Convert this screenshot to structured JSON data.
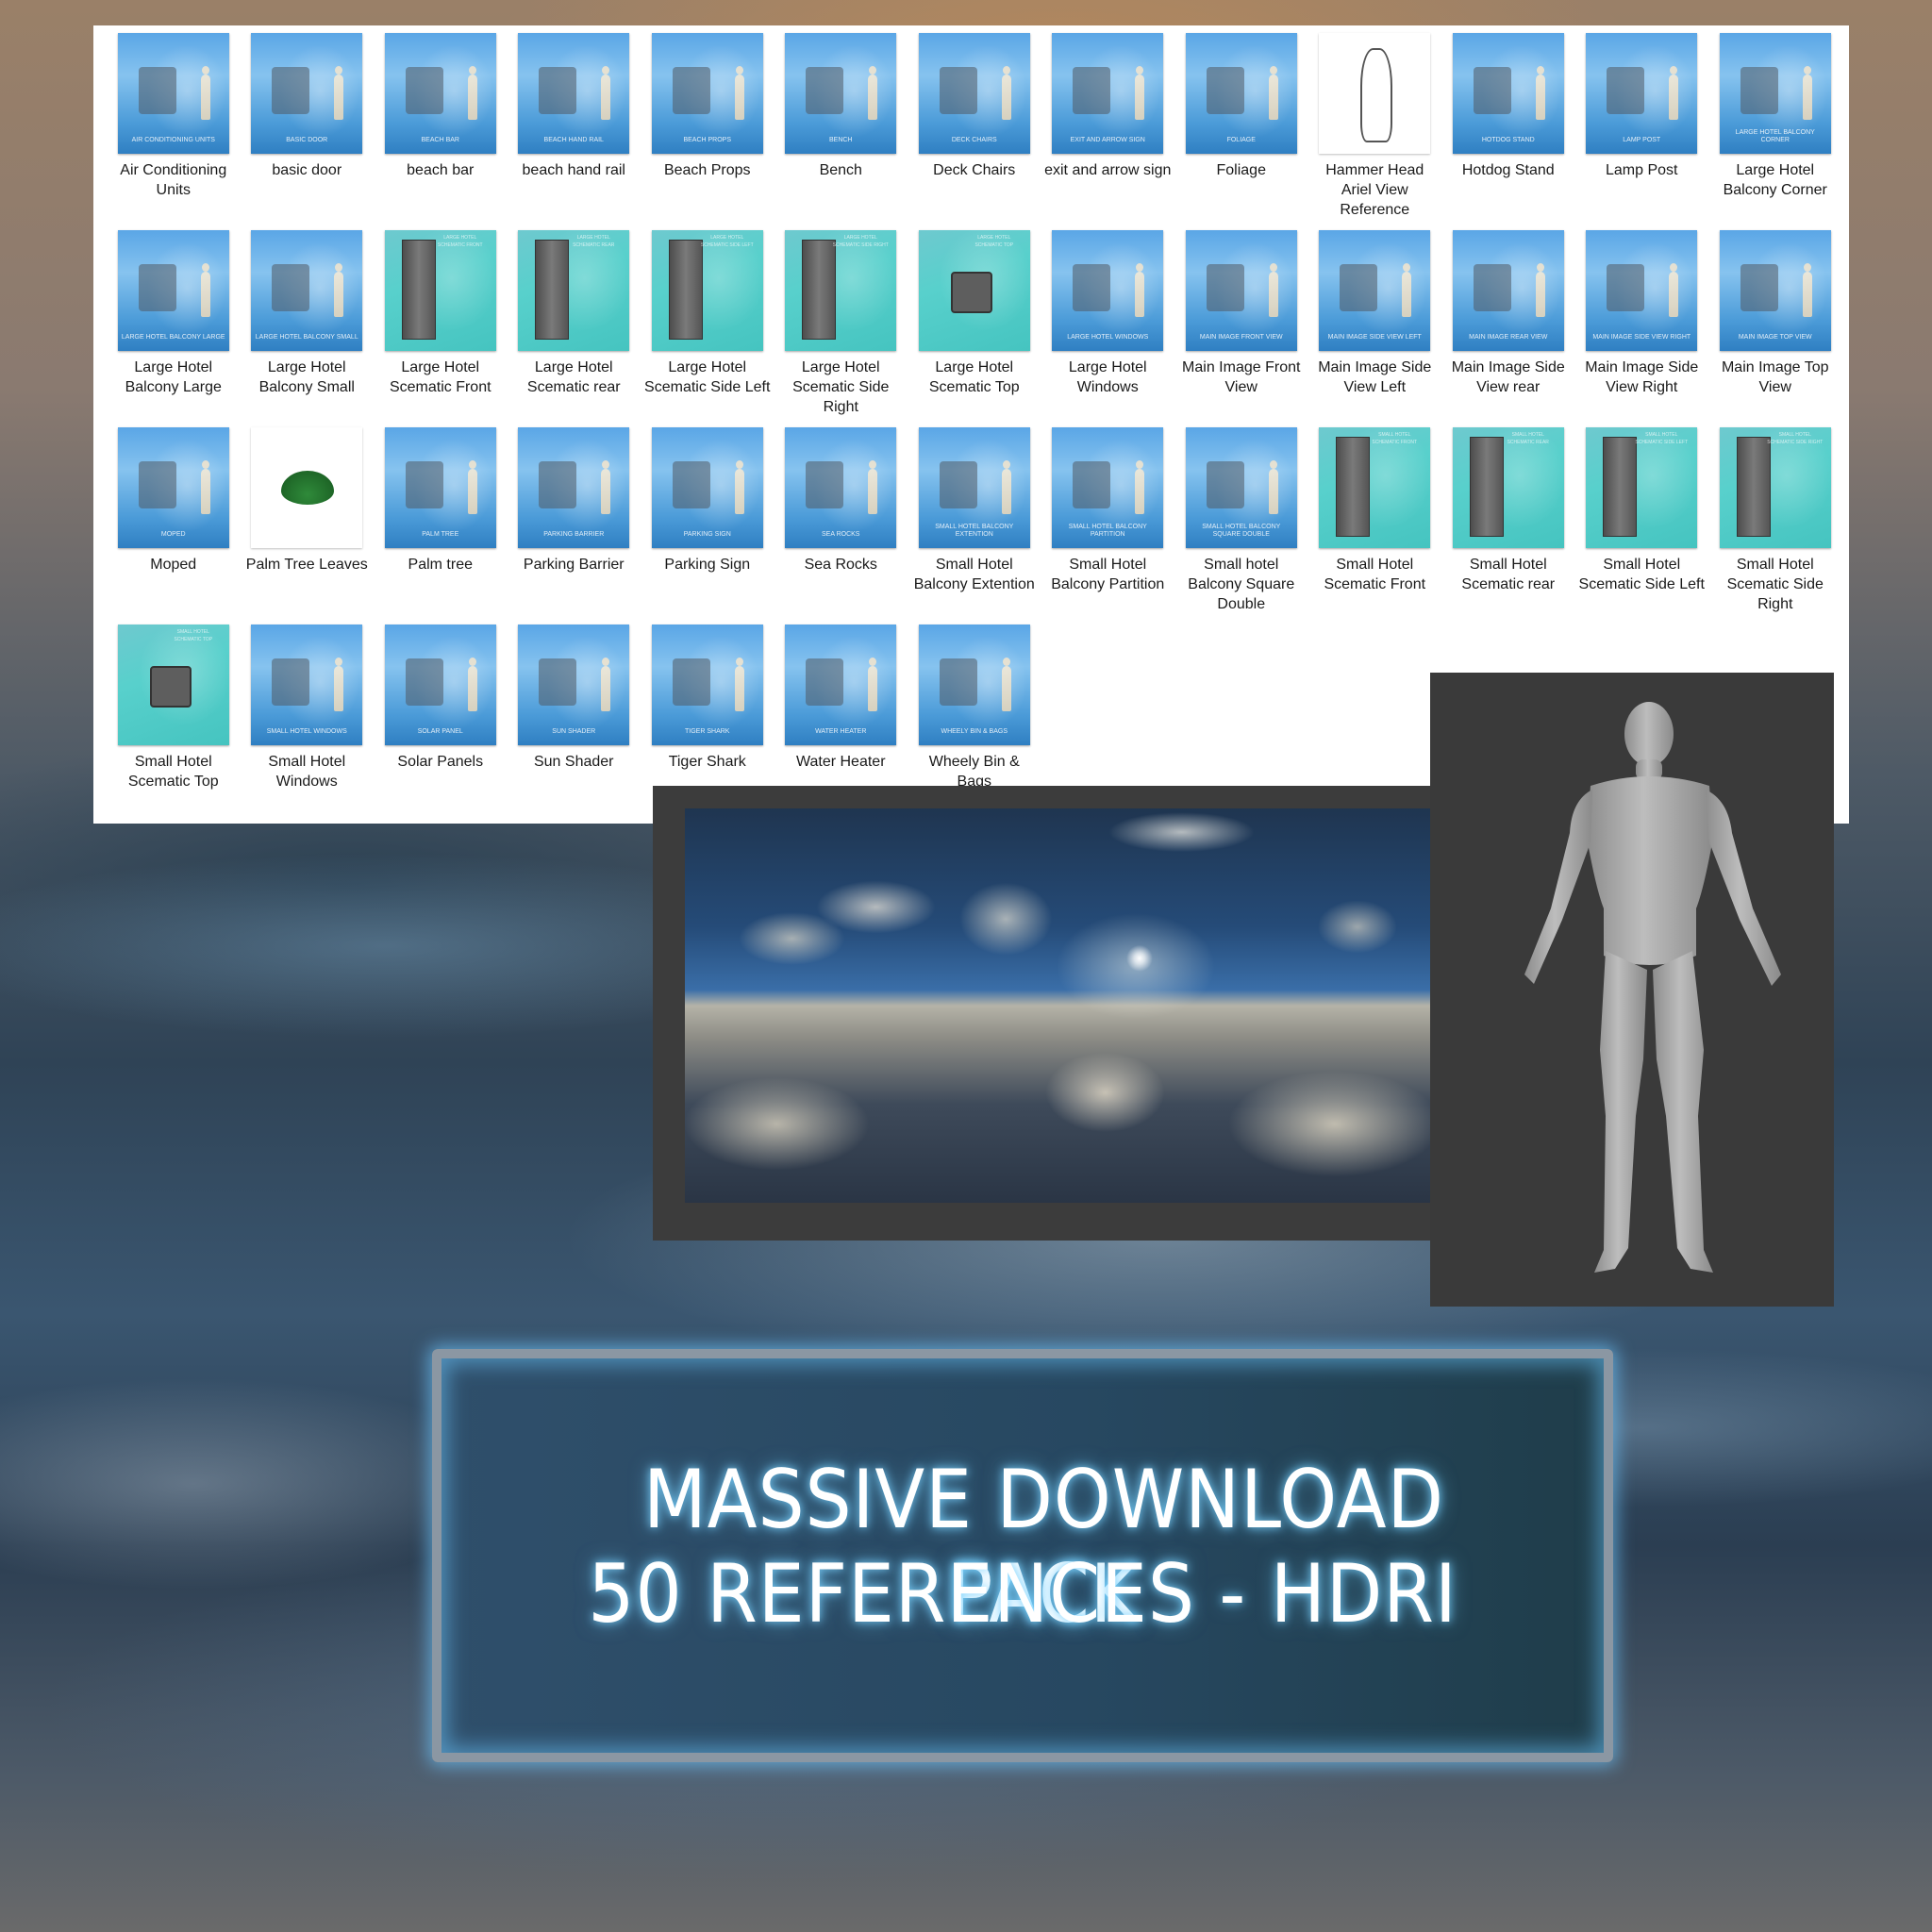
{
  "explorer": {
    "files": [
      {
        "label": "Air Conditioning Units",
        "thumb_caption": "AIR CONDITIONING UNITS",
        "style": "blue",
        "icon": "air-conditioner-icon"
      },
      {
        "label": "basic door",
        "thumb_caption": "BASIC DOOR",
        "style": "blue",
        "icon": "door-icon"
      },
      {
        "label": "beach bar",
        "thumb_caption": "BEACH BAR",
        "style": "blue",
        "icon": "beach-bar-icon"
      },
      {
        "label": "beach hand rail",
        "thumb_caption": "BEACH HAND RAIL",
        "style": "blue",
        "icon": "hand-rail-icon"
      },
      {
        "label": "Beach Props",
        "thumb_caption": "BEACH PROPS",
        "style": "blue",
        "icon": "surfboard-icon"
      },
      {
        "label": "Bench",
        "thumb_caption": "BENCH",
        "style": "blue",
        "icon": "bench-icon"
      },
      {
        "label": "Deck Chairs",
        "thumb_caption": "DECK CHAIRS",
        "style": "blue",
        "icon": "deck-chair-icon"
      },
      {
        "label": "exit and arrow sign",
        "thumb_caption": "EXIT AND ARROW SIGN",
        "style": "blue",
        "icon": "exit-sign-icon"
      },
      {
        "label": "Foliage",
        "thumb_caption": "FOLIAGE",
        "style": "blue",
        "icon": "foliage-icon"
      },
      {
        "label": "Hammer Head Ariel View Reference",
        "thumb_caption": "",
        "style": "white",
        "icon": "hammerhead-shark-icon"
      },
      {
        "label": "Hotdog Stand",
        "thumb_caption": "HOTDOG STAND",
        "style": "blue",
        "icon": "hotdog-stand-icon"
      },
      {
        "label": "Lamp Post",
        "thumb_caption": "LAMP POST",
        "style": "blue",
        "icon": "lamp-post-icon"
      },
      {
        "label": "Large Hotel Balcony Corner",
        "thumb_caption": "LARGE HOTEL BALCONY CORNER",
        "style": "blue",
        "icon": "balcony-icon"
      },
      {
        "label": "Large Hotel Balcony Large",
        "thumb_caption": "LARGE HOTEL BALCONY LARGE",
        "style": "blue",
        "icon": "balcony-icon"
      },
      {
        "label": "Large Hotel Balcony Small",
        "thumb_caption": "LARGE HOTEL BALCONY SMALL",
        "style": "blue",
        "icon": "balcony-icon"
      },
      {
        "label": "Large Hotel Scematic Front",
        "thumb_caption": "LARGE HOTEL SCHEMATIC FRONT",
        "style": "teal",
        "icon": "building-icon"
      },
      {
        "label": "Large Hotel Scematic rear",
        "thumb_caption": "LARGE HOTEL SCHEMATIC REAR",
        "style": "teal",
        "icon": "building-icon"
      },
      {
        "label": "Large Hotel Scematic Side Left",
        "thumb_caption": "LARGE HOTEL SCHEMATIC SIDE LEFT",
        "style": "teal",
        "icon": "building-icon"
      },
      {
        "label": "Large Hotel Scematic Side Right",
        "thumb_caption": "LARGE HOTEL SCHEMATIC SIDE RIGHT",
        "style": "teal",
        "icon": "building-icon"
      },
      {
        "label": "Large Hotel Scematic Top",
        "thumb_caption": "LARGE HOTEL SCHEMATIC TOP",
        "style": "teal",
        "icon": "building-top-icon"
      },
      {
        "label": "Large Hotel Windows",
        "thumb_caption": "LARGE HOTEL WINDOWS",
        "style": "blue",
        "icon": "window-icon"
      },
      {
        "label": "Main Image Front View",
        "thumb_caption": "MAIN IMAGE FRONT VIEW",
        "style": "blue",
        "icon": "hotel-scene-icon"
      },
      {
        "label": "Main Image Side View Left",
        "thumb_caption": "MAIN IMAGE SIDE VIEW LEFT",
        "style": "blue",
        "icon": "hotel-scene-icon"
      },
      {
        "label": "Main Image Side View rear",
        "thumb_caption": "MAIN IMAGE REAR VIEW",
        "style": "blue",
        "icon": "hotel-scene-icon"
      },
      {
        "label": "Main Image Side View Right",
        "thumb_caption": "MAIN IMAGE SIDE VIEW RIGHT",
        "style": "blue",
        "icon": "hotel-scene-icon"
      },
      {
        "label": "Main Image Top View",
        "thumb_caption": "MAIN IMAGE TOP VIEW",
        "style": "blue",
        "icon": "map-top-view-icon"
      },
      {
        "label": "Moped",
        "thumb_caption": "MOPED",
        "style": "blue",
        "icon": "moped-icon"
      },
      {
        "label": "Palm Tree Leaves",
        "thumb_caption": "",
        "style": "white",
        "icon": "palm-leaf-icon"
      },
      {
        "label": "Palm tree",
        "thumb_caption": "PALM TREE",
        "style": "blue",
        "icon": "palm-tree-icon"
      },
      {
        "label": "Parking Barrier",
        "thumb_caption": "PARKING BARRIER",
        "style": "blue",
        "icon": "parking-barrier-icon"
      },
      {
        "label": "Parking Sign",
        "thumb_caption": "PARKING SIGN",
        "style": "blue",
        "icon": "parking-sign-icon"
      },
      {
        "label": "Sea Rocks",
        "thumb_caption": "SEA ROCKS",
        "style": "blue",
        "icon": "rock-icon"
      },
      {
        "label": "Small Hotel Balcony Extention",
        "thumb_caption": "SMALL HOTEL BALCONY EXTENTION",
        "style": "blue",
        "icon": "balcony-icon"
      },
      {
        "label": "Small Hotel Balcony Partition",
        "thumb_caption": "SMALL HOTEL BALCONY PARTITION",
        "style": "blue",
        "icon": "balcony-icon"
      },
      {
        "label": "Small hotel Balcony Square Double",
        "thumb_caption": "SMALL HOTEL BALCONY SQUARE DOUBLE",
        "style": "blue",
        "icon": "balcony-icon"
      },
      {
        "label": "Small Hotel Scematic Front",
        "thumb_caption": "SMALL HOTEL SCHEMATIC FRONT",
        "style": "teal",
        "icon": "building-icon"
      },
      {
        "label": "Small Hotel Scematic rear",
        "thumb_caption": "SMALL HOTEL SCHEMATIC REAR",
        "style": "teal",
        "icon": "building-icon"
      },
      {
        "label": "Small Hotel Scematic Side Left",
        "thumb_caption": "SMALL HOTEL SCHEMATIC SIDE LEFT",
        "style": "teal",
        "icon": "building-icon"
      },
      {
        "label": "Small Hotel Scematic Side Right",
        "thumb_caption": "SMALL HOTEL SCHEMATIC SIDE RIGHT",
        "style": "teal",
        "icon": "building-icon"
      },
      {
        "label": "Small Hotel Scematic Top",
        "thumb_caption": "SMALL HOTEL SCHEMATIC TOP",
        "style": "teal",
        "icon": "building-top-icon"
      },
      {
        "label": "Small Hotel Windows",
        "thumb_caption": "SMALL HOTEL WINDOWS",
        "style": "blue",
        "icon": "window-icon"
      },
      {
        "label": "Solar Panels",
        "thumb_caption": "SOLAR PANEL",
        "style": "blue",
        "icon": "solar-panel-icon"
      },
      {
        "label": "Sun Shader",
        "thumb_caption": "SUN SHADER",
        "style": "blue",
        "icon": "umbrella-icon"
      },
      {
        "label": "Tiger Shark",
        "thumb_caption": "TIGER SHARK",
        "style": "blue",
        "icon": "shark-icon"
      },
      {
        "label": "Water Heater",
        "thumb_caption": "WATER HEATER",
        "style": "blue",
        "icon": "water-heater-icon"
      },
      {
        "label": "Wheely Bin & Bags",
        "thumb_caption": "WHEELY BIN & BAGS",
        "style": "blue",
        "icon": "wheelie-bin-icon"
      }
    ]
  },
  "hdri_preview": {
    "description": "HDRI sky panorama with clouds and sun"
  },
  "figure_preview": {
    "description": "Grey human base mesh reference figure"
  },
  "banner": {
    "line1": "MASSIVE DOWNLOAD PACK",
    "line2": "50 REFERENCES - HDRI"
  },
  "colors": {
    "banner_glow": "#6ec8ff",
    "banner_bg": "#274861",
    "thumb_blue": "#5aa6e6",
    "thumb_teal": "#58d0cc"
  }
}
